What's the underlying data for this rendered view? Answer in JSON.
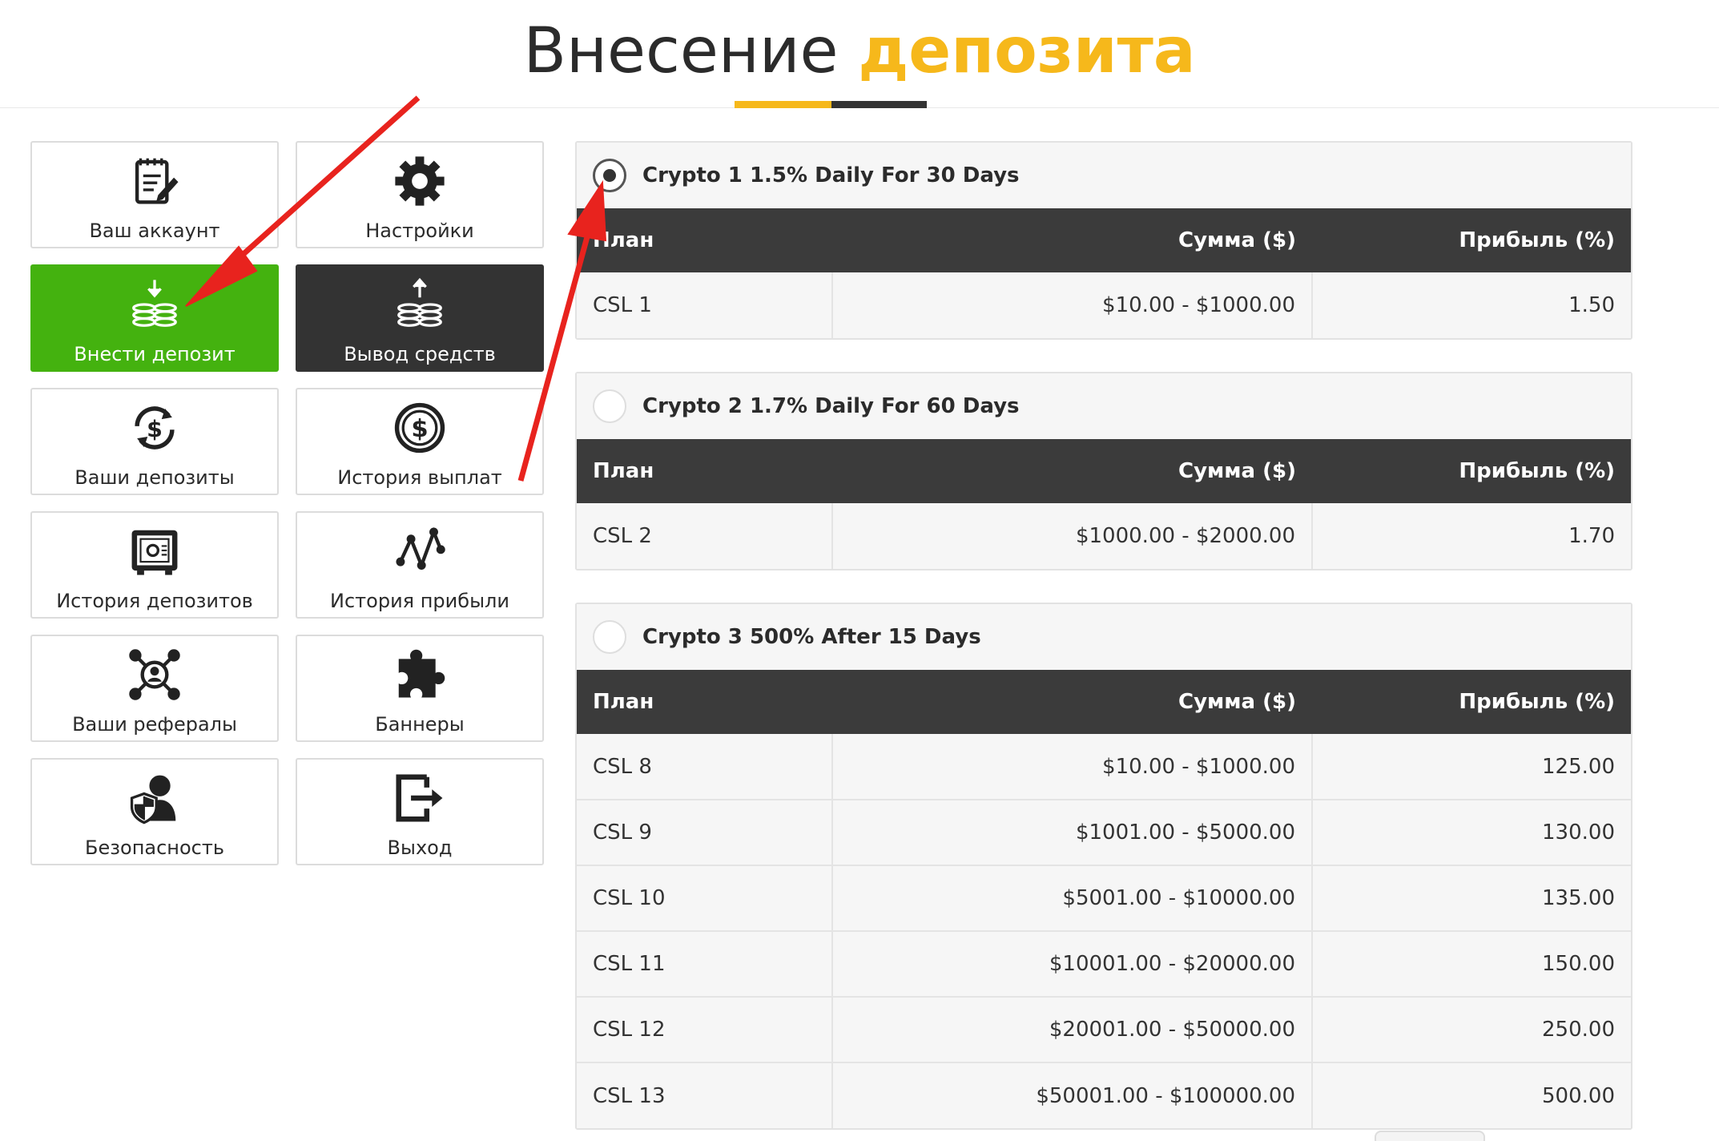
{
  "header": {
    "title_part1": "Внесение",
    "title_part2": "депозита",
    "accent_color": "#f6b81b"
  },
  "menu": {
    "items": [
      {
        "label": "Ваш аккаунт",
        "icon": "edit-document-icon"
      },
      {
        "label": "Настройки",
        "icon": "gear-icon"
      },
      {
        "label": "Внести депозит",
        "icon": "deposit-coins-icon",
        "state": "active"
      },
      {
        "label": "Вывод средств",
        "icon": "withdraw-coins-icon",
        "state": "dark"
      },
      {
        "label": "Ваши депозиты",
        "icon": "dollar-refresh-icon"
      },
      {
        "label": "История выплат",
        "icon": "dollar-circle-icon"
      },
      {
        "label": "История депозитов",
        "icon": "safe-icon"
      },
      {
        "label": "История прибыли",
        "icon": "line-chart-icon"
      },
      {
        "label": "Ваши рефералы",
        "icon": "referral-network-icon"
      },
      {
        "label": "Баннеры",
        "icon": "puzzle-icon"
      },
      {
        "label": "Безопасность",
        "icon": "user-shield-icon"
      },
      {
        "label": "Выход",
        "icon": "logout-icon"
      }
    ],
    "active_color": "#44b20f",
    "dark_color": "#333333"
  },
  "plans": [
    {
      "name": "Crypto 1 1.5% Daily For 30 Days",
      "selected": true,
      "headers": [
        "План",
        "Сумма ($)",
        "Прибыль (%)"
      ],
      "rows": [
        [
          "CSL 1",
          "$10.00 - $1000.00",
          "1.50"
        ]
      ]
    },
    {
      "name": "Crypto 2 1.7% Daily For 60 Days",
      "selected": false,
      "headers": [
        "План",
        "Сумма ($)",
        "Прибыль (%)"
      ],
      "rows": [
        [
          "CSL 2",
          "$1000.00 - $2000.00",
          "1.70"
        ]
      ]
    },
    {
      "name": "Crypto 3 500% After 15 Days",
      "selected": false,
      "headers": [
        "План",
        "Сумма ($)",
        "Прибыль (%)"
      ],
      "rows": [
        [
          "CSL 8",
          "$10.00 - $1000.00",
          "125.00"
        ],
        [
          "CSL 9",
          "$1001.00 - $5000.00",
          "130.00"
        ],
        [
          "CSL 10",
          "$5001.00 - $10000.00",
          "135.00"
        ],
        [
          "CSL 11",
          "$10001.00 - $20000.00",
          "150.00"
        ],
        [
          "CSL 12",
          "$20001.00 - $50000.00",
          "250.00"
        ],
        [
          "CSL 13",
          "$50001.00 - $100000.00",
          "500.00"
        ]
      ]
    }
  ],
  "annotation_color": "#e8231e"
}
